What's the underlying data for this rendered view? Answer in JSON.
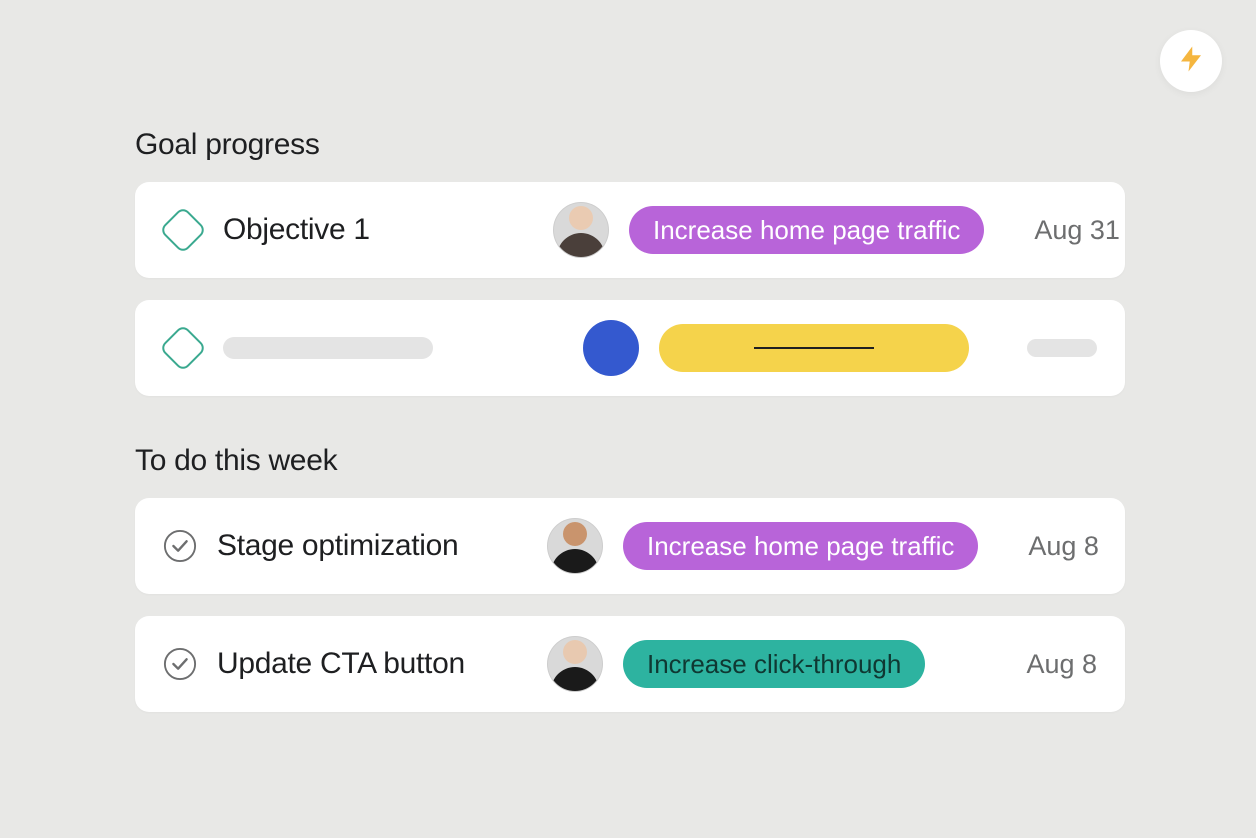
{
  "fab": {
    "icon_name": "lightning-icon",
    "icon_color": "#f5b63f"
  },
  "sections": {
    "goal_progress": {
      "title": "Goal progress",
      "items": [
        {
          "icon": "diamond",
          "title": "Objective 1",
          "avatar_color": "#d9d9d9",
          "tag": {
            "label": "Increase home page traffic",
            "color": "purple"
          },
          "date": "Aug 31"
        },
        {
          "icon": "diamond",
          "placeholder": true,
          "avatar_color": "#3459cf",
          "tag_color": "#f5d34b"
        }
      ]
    },
    "todo": {
      "title": "To do this week",
      "items": [
        {
          "icon": "check",
          "title": "Stage optimization",
          "avatar_color": "#d9d9d9",
          "tag": {
            "label": "Increase home page traffic",
            "color": "purple"
          },
          "date": "Aug 8"
        },
        {
          "icon": "check",
          "title": "Update CTA button",
          "avatar_color": "#d9d9d9",
          "tag": {
            "label": "Increase click-through",
            "color": "teal"
          },
          "date": "Aug 8"
        }
      ]
    }
  },
  "colors": {
    "purple": "#b864d9",
    "teal": "#2db3a0",
    "yellow": "#f5d34b",
    "blue": "#3459cf",
    "diamond_border": "#3aa98f"
  }
}
